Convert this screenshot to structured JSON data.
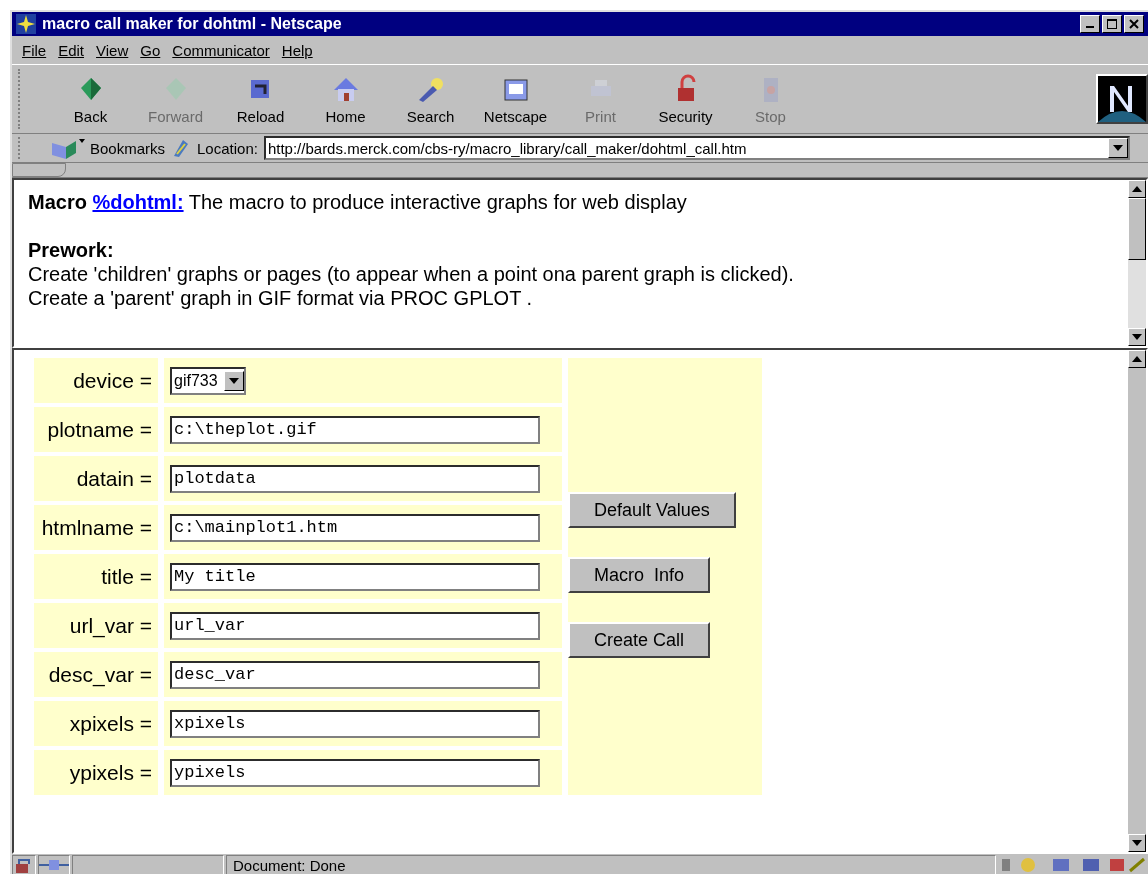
{
  "window": {
    "title": "macro call maker for dohtml - Netscape"
  },
  "menu": [
    "File",
    "Edit",
    "View",
    "Go",
    "Communicator",
    "Help"
  ],
  "toolbar": [
    {
      "label": "Back",
      "disabled": false
    },
    {
      "label": "Forward",
      "disabled": true
    },
    {
      "label": "Reload",
      "disabled": false
    },
    {
      "label": "Home",
      "disabled": false
    },
    {
      "label": "Search",
      "disabled": false
    },
    {
      "label": "Netscape",
      "disabled": false
    },
    {
      "label": "Print",
      "disabled": true
    },
    {
      "label": "Security",
      "disabled": false
    },
    {
      "label": "Stop",
      "disabled": true
    }
  ],
  "location_bar": {
    "bookmarks": "Bookmarks",
    "label": "Location:",
    "url": "http://bards.merck.com/cbs-ry/macro_library/call_maker/dohtml_call.htm"
  },
  "top_frame": {
    "heading_prefix": "Macro",
    "link": "%dohtml:",
    "heading_text": "The macro to produce interactive graphs for web display",
    "prework_title": "Prework:",
    "lines": [
      "Create 'children' graphs or pages (to appear when a point ona parent graph is clicked).",
      "Create a 'parent' graph in GIF format via PROC GPLOT ."
    ]
  },
  "form": {
    "fields": [
      {
        "label": "device =",
        "kind": "select",
        "value": "gif733"
      },
      {
        "label": "plotname =",
        "kind": "text",
        "value": "c:\\theplot.gif"
      },
      {
        "label": "datain =",
        "kind": "text",
        "value": "plotdata"
      },
      {
        "label": "htmlname =",
        "kind": "text",
        "value": "c:\\mainplot1.htm"
      },
      {
        "label": "title =",
        "kind": "text",
        "value": "My title"
      },
      {
        "label": "url_var =",
        "kind": "text",
        "value": "url_var"
      },
      {
        "label": "desc_var =",
        "kind": "text",
        "value": "desc_var"
      },
      {
        "label": "xpixels =",
        "kind": "text",
        "value": "xpixels"
      },
      {
        "label": "ypixels =",
        "kind": "text",
        "value": "ypixels"
      }
    ],
    "buttons": [
      "Default Values",
      "Macro  Info",
      "Create Call"
    ]
  },
  "status_bar": {
    "text": "Document: Done"
  }
}
